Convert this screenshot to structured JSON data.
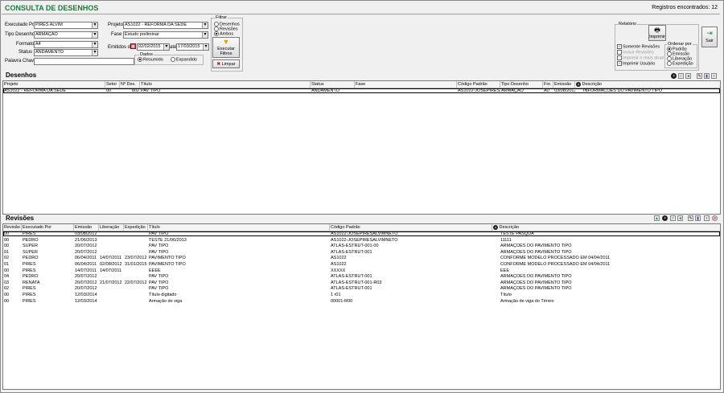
{
  "header": {
    "title": "CONSULTA DE DESENHOS",
    "registros": "Registros encontrados: 12"
  },
  "filters": {
    "executado_por_label": "Executado Por",
    "executado_por": "PIRES ALVIM",
    "tipo_desenho_label": "Tipo Desenho",
    "tipo_desenho": "ARMAÇÃO",
    "formato_label": "Formato",
    "formato": "A4",
    "status_label": "Status",
    "status": "ANDAMENTO",
    "palavra_chave_label": "Palavra Chave",
    "palavra_chave": "",
    "projeto_label": "Projeto",
    "projeto": "AS1022 - REFORMA DA SEDE",
    "fase_label": "Fase",
    "fase": "Estudo preliminar",
    "emitidos_label": "Emitidos de",
    "data_de": "02/02/2015",
    "ate_label": "até",
    "data_ate": "17/03/2015",
    "dados_label": "Dados",
    "resumido": "Resumido",
    "expandido": "Expandido",
    "filtrar_label": "Filtrar",
    "opt_desenhos": "Desenhos",
    "opt_revisoes": "Revisões",
    "opt_ambos": "Ambos",
    "executar_label": "Executar Filtros",
    "limpar_label": "Limpar"
  },
  "relatorio": {
    "label": "Relatório",
    "imprimir": "Imprimir",
    "somente_revisoes": "Somente Revisões",
    "incluir_revisoes": "Incluir Revisões",
    "imprimir_mais_atual": "Imprimir o mais atual",
    "imprimir_usuario": "Imprimir Usuário",
    "ordenar_label": "Ordenar por",
    "padrao": "Padrão",
    "emissao": "Emissão",
    "liberacao": "Liberação",
    "expedicao": "Expedição",
    "sair": "Sair"
  },
  "desenhos": {
    "title": "Desenhos",
    "headers": {
      "projeto": "Projeto",
      "setor": "Setor",
      "num": "Nº Des.",
      "titulo": "Título",
      "status": "Status",
      "fase": "Fase",
      "codigo": "Código Padrão",
      "tipo": "Tipo Desenho",
      "for": "For.",
      "emissao": "Emissão",
      "descricao": "Descrição"
    },
    "rows": [
      {
        "projeto": "AS1022 - REFORMA DA SEDE",
        "setor": "00",
        "num": "802",
        "titulo": "PAV TIPO",
        "status": "ANDAMENTO",
        "fase": "",
        "codigo": "AS1022-JOSEPIRESAL",
        "tipo": "ARMAÇÃO",
        "for": "A0",
        "emissao": "03/08/2012",
        "descricao": "INFORMACOES DO PAVIMENTO TIPO"
      }
    ]
  },
  "revisoes": {
    "title": "Revisões",
    "headers": {
      "revisao": "Revisão",
      "executado": "Executado Por",
      "emissao": "Emissão",
      "liberacao": "Liberação",
      "expedicao": "Expedição",
      "titulo": "Título",
      "codigo": "Código Padrão",
      "descricao": "Descrição"
    },
    "rows": [
      {
        "revisao": "00",
        "executado": "PIRES",
        "emissao": "03/08/2012",
        "liberacao": "",
        "expedicao": "",
        "titulo": "PAV TIPO",
        "codigo": "AS1022-JOSEPIRESALVIMNETO",
        "descricao": "TESTE PASQUA"
      },
      {
        "revisao": "00",
        "executado": "PEDRO",
        "emissao": "21/06/2013",
        "liberacao": "",
        "expedicao": "",
        "titulo": "TESTE 21/06/2013",
        "codigo": "AS1022-JOSEPIRESALVIMNETO",
        "descricao": "11111"
      },
      {
        "revisao": "00",
        "executado": "SUPER",
        "emissao": "20/07/2012",
        "liberacao": "",
        "expedicao": "",
        "titulo": "PAV TIPO",
        "codigo": "ATLAS-ESTRUT-001-00",
        "descricao": "ARMAÇÕES DO PAVIMENTO TIPO"
      },
      {
        "revisao": "01",
        "executado": "SUPER",
        "emissao": "20/07/2012",
        "liberacao": "",
        "expedicao": "",
        "titulo": "PAV TIPO",
        "codigo": "ATLAS-ESTRUT-001",
        "descricao": "ARMAÇÕES DO PAVIMENTO TIPO"
      },
      {
        "revisao": "02",
        "executado": "PEDRO",
        "emissao": "06/04/2011",
        "liberacao": "14/07/2011",
        "expedicao": "23/07/2012",
        "titulo": "PAVIMENTO TIPO",
        "codigo": "AS1022",
        "descricao": "CONFORME MODELO PROCESSADO EM 04/04/2011"
      },
      {
        "revisao": "01",
        "executado": "PIRES",
        "emissao": "06/04/2011",
        "liberacao": "02/08/2012",
        "expedicao": "31/01/2015",
        "titulo": "PAVIMENTO TIPO",
        "codigo": "AS1022",
        "descricao": "CONFORME MODELO PROCESSADO EM 04/04/2011"
      },
      {
        "revisao": "00",
        "executado": "PIRES",
        "emissao": "14/07/2011",
        "liberacao": "14/07/2011",
        "expedicao": "",
        "titulo": "EEEE",
        "codigo": "XXXXX",
        "descricao": "EEE"
      },
      {
        "revisao": "04",
        "executado": "PEDRO",
        "emissao": "20/07/2012",
        "liberacao": "",
        "expedicao": "",
        "titulo": "PAV TIPO",
        "codigo": "ATLAS-ESTRUT-001",
        "descricao": "ARMAÇÕES DO PAVIMENTO TIPO"
      },
      {
        "revisao": "03",
        "executado": "RENATA",
        "emissao": "20/07/2012",
        "liberacao": "21/07/2012",
        "expedicao": "22/07/2012",
        "titulo": "PAV TIPO",
        "codigo": "ATLAS-ESTRUT-001-R03",
        "descricao": "ARMAÇÕES DO PAVIMENTO TIPO"
      },
      {
        "revisao": "02",
        "executado": "PIRES",
        "emissao": "20/07/2012",
        "liberacao": "",
        "expedicao": "",
        "titulo": "PAV TIPO",
        "codigo": "ATLAS-ESTRUT-001",
        "descricao": "ARMAÇÕES DO PAVIMENTO TIPO"
      },
      {
        "revisao": "00",
        "executado": "PIRES",
        "emissao": "12/03/2014",
        "liberacao": "",
        "expedicao": "",
        "titulo": "Título digitado",
        "codigo": "1 r01",
        "descricao": "Título"
      },
      {
        "revisao": "00",
        "executado": "PIRES",
        "emissao": "12/03/2014",
        "liberacao": "",
        "expedicao": "",
        "titulo": "Armação de viga",
        "codigo": "00001-R00",
        "descricao": "Armação de viga do Térreo"
      }
    ]
  }
}
